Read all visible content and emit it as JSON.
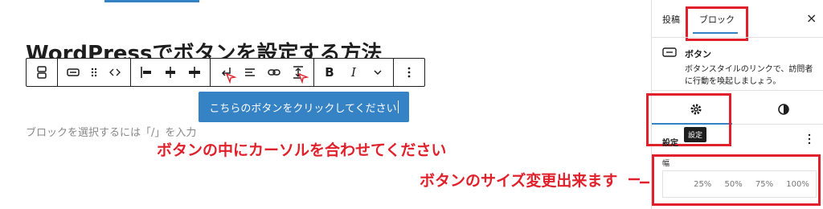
{
  "editor": {
    "post_title": "WordPressでボタンを設定する方法",
    "button_text": "こちらのボタンをクリックしてください",
    "hint": "ブロックを選択するには「/」を入力"
  },
  "toolbar": {
    "icons": [
      "buttons-parent-icon",
      "button-block-icon",
      "drag-handle-icon",
      "move-arrows-icon",
      "justify-left-icon",
      "justify-center-icon",
      "justify-space-icon",
      "enter-icon",
      "vertical-align-icon",
      "link-icon",
      "font-size-icon",
      "bold-icon",
      "italic-icon",
      "more-chevron-icon",
      "options-icon"
    ],
    "bold_label": "B",
    "italic_label": "I"
  },
  "annotations": {
    "cursor_note": "ボタンの中にカーソルを合わせてください",
    "size_note": "ボタンのサイズ変更出来ます"
  },
  "sidebar": {
    "tab_post": "投稿",
    "tab_block": "ブロック",
    "close": "×",
    "block_title": "ボタン",
    "block_desc_1": "ボタンスタイルのリンクで、訪問者",
    "block_desc_2": "に行動を喚起しましょう。",
    "tooltip": "設定",
    "settings_label": "設定",
    "width_label": "幅",
    "width_options": [
      "25%",
      "50%",
      "75%",
      "100%"
    ]
  },
  "colors": {
    "accent": "#3582c4",
    "annotation": "#e0202a"
  }
}
